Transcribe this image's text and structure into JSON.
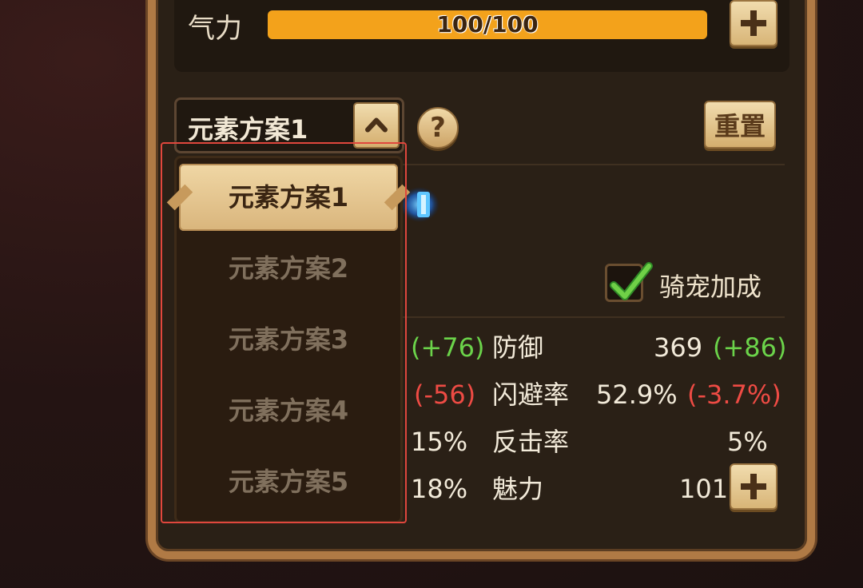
{
  "energy": {
    "label": "气力",
    "value_text": "100/100",
    "current": 100,
    "max": 100
  },
  "scheme_selector": {
    "selected_label": "元素方案1"
  },
  "help": {
    "glyph": "?"
  },
  "reset": {
    "label": "重置"
  },
  "dropdown": {
    "items": [
      {
        "label": "元素方案1",
        "selected": true
      },
      {
        "label": "元素方案2",
        "selected": false
      },
      {
        "label": "元素方案3",
        "selected": false
      },
      {
        "label": "元素方案4",
        "selected": false
      },
      {
        "label": "元素方案5",
        "selected": false
      }
    ]
  },
  "mount_bonus": {
    "label": "骑宠加成",
    "checked": true
  },
  "stats_left": [
    {
      "delta": "(+76)",
      "delta_color": "green"
    },
    {
      "delta": "(-56)",
      "delta_color": "red"
    },
    {
      "value": "15%"
    },
    {
      "value": "18%"
    }
  ],
  "stats_right": [
    {
      "name": "防御",
      "value": "369",
      "delta": "(+86)",
      "delta_color": "green"
    },
    {
      "name": "闪避率",
      "value": "52.9%",
      "delta": "(-3.7%)",
      "delta_color": "red"
    },
    {
      "name": "反击率",
      "value": "5%"
    },
    {
      "name": "魅力",
      "value": "101"
    }
  ],
  "colors": {
    "accent_bar": "#f3a21b",
    "positive": "#6bd34a",
    "negative": "#ee4b44",
    "highlight": "#e0473d"
  }
}
